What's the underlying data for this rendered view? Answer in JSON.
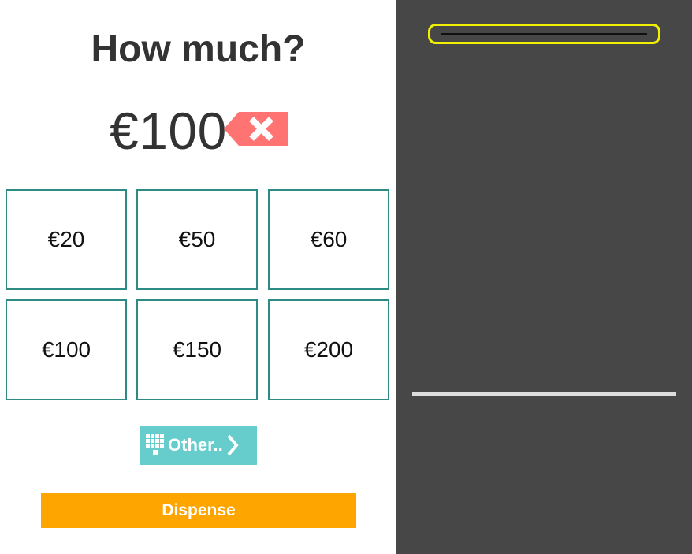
{
  "title": "How much?",
  "amount_display": "€100",
  "quick_amounts": [
    "€20",
    "€50",
    "€60",
    "€100",
    "€150",
    "€200"
  ],
  "other_button_label": "Other..",
  "dispense_button_label": "Dispense",
  "colors": {
    "amount_button_border": "#2e8b84",
    "clear_button": "#ff7373",
    "other_button": "#66cccc",
    "dispense_button": "#ffa500",
    "machine_panel": "#474747",
    "card_slot_highlight": "#f0f000",
    "cash_slot": "#dddddd"
  },
  "icons": {
    "clear": "backspace-x-icon",
    "other": "keypad-icon",
    "other_arrow": "chevron-right-icon"
  }
}
